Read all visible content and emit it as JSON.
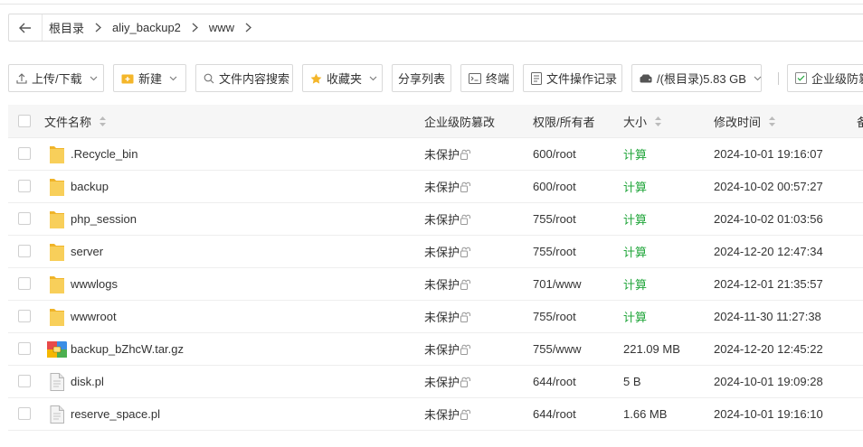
{
  "breadcrumb": {
    "items": [
      "根目录",
      "aliy_backup2",
      "www"
    ]
  },
  "toolbar": {
    "upload": "上传/下载",
    "new": "新建",
    "search": "文件内容搜索",
    "favorites": "收藏夹",
    "share_list": "分享列表",
    "terminal": "终端",
    "op_log": "文件操作记录",
    "disk": "/(根目录)5.83 GB",
    "enterprise": "企业级防篡"
  },
  "table": {
    "headers": {
      "name": "文件名称",
      "protect": "企业级防篡改",
      "perm": "权限/所有者",
      "size": "大小",
      "mtime": "修改时间",
      "extra": "备"
    },
    "rows": [
      {
        "icon": "folder-icon",
        "name": ".Recycle_bin",
        "protect": "未保护",
        "perm": "600/root",
        "size": "计算",
        "mtime": "2024-10-01 19:16:07"
      },
      {
        "icon": "folder-icon",
        "name": "backup",
        "protect": "未保护",
        "perm": "600/root",
        "size": "计算",
        "mtime": "2024-10-02 00:57:27"
      },
      {
        "icon": "folder-icon",
        "name": "php_session",
        "protect": "未保护",
        "perm": "755/root",
        "size": "计算",
        "mtime": "2024-10-02 01:03:56"
      },
      {
        "icon": "folder-icon",
        "name": "server",
        "protect": "未保护",
        "perm": "755/root",
        "size": "计算",
        "mtime": "2024-12-20 12:47:34"
      },
      {
        "icon": "folder-icon",
        "name": "wwwlogs",
        "protect": "未保护",
        "perm": "701/www",
        "size": "计算",
        "mtime": "2024-12-01 21:35:57"
      },
      {
        "icon": "folder-icon",
        "name": "wwwroot",
        "protect": "未保护",
        "perm": "755/root",
        "size": "计算",
        "mtime": "2024-11-30 11:27:38"
      },
      {
        "icon": "archive-icon",
        "name": "backup_bZhcW.tar.gz",
        "protect": "未保护",
        "perm": "755/www",
        "size": "221.09 MB",
        "mtime": "2024-12-20 12:45:22"
      },
      {
        "icon": "file-icon",
        "name": "disk.pl",
        "protect": "未保护",
        "perm": "644/root",
        "size": "5 B",
        "mtime": "2024-10-01 19:09:28"
      },
      {
        "icon": "file-icon",
        "name": "reserve_space.pl",
        "protect": "未保护",
        "perm": "644/root",
        "size": "1.66 MB",
        "mtime": "2024-10-01 19:16:10"
      }
    ]
  },
  "colors": {
    "accent_green": "#20a53a",
    "folder": "#f6c443",
    "border": "#d9d9d9"
  }
}
